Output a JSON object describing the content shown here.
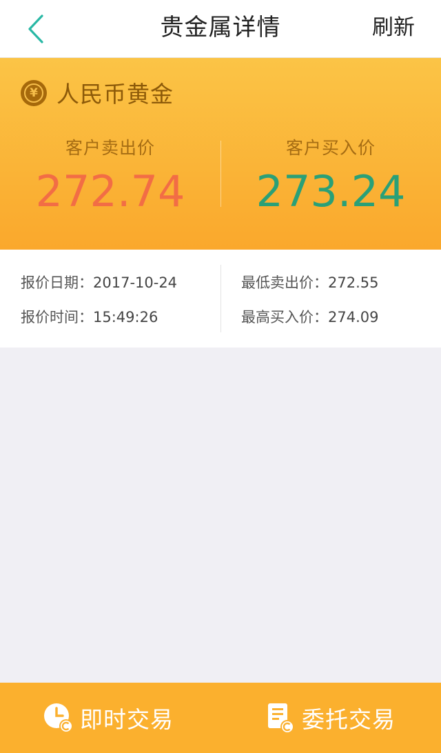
{
  "header": {
    "title": "贵金属详情",
    "refresh_label": "刷新",
    "back_icon": "chevron-left-icon",
    "accent_color": "#29b8a5"
  },
  "product": {
    "name": "人民币黄金",
    "icon": "yuan-coin-icon",
    "icon_glyph": "¥"
  },
  "prices": {
    "sell_label": "客户卖出价",
    "sell_value": "272.74",
    "sell_color": "#f26d45",
    "buy_label": "客户买入价",
    "buy_value": "273.24",
    "buy_color": "#2aa077"
  },
  "info": {
    "date_label": "报价日期：",
    "date_value": "2017-10-24",
    "time_label": "报价时间：",
    "time_value": "15:49:26",
    "min_sell_label": "最低卖出价：",
    "min_sell_value": "272.55",
    "max_buy_label": "最高买入价：",
    "max_buy_value": "274.09"
  },
  "bottom_bar": {
    "instant_trade_label": "即时交易",
    "instant_trade_icon": "clock-coin-icon",
    "entrust_trade_label": "委托交易",
    "entrust_trade_icon": "document-coin-icon",
    "bar_color": "#fbb02e"
  }
}
